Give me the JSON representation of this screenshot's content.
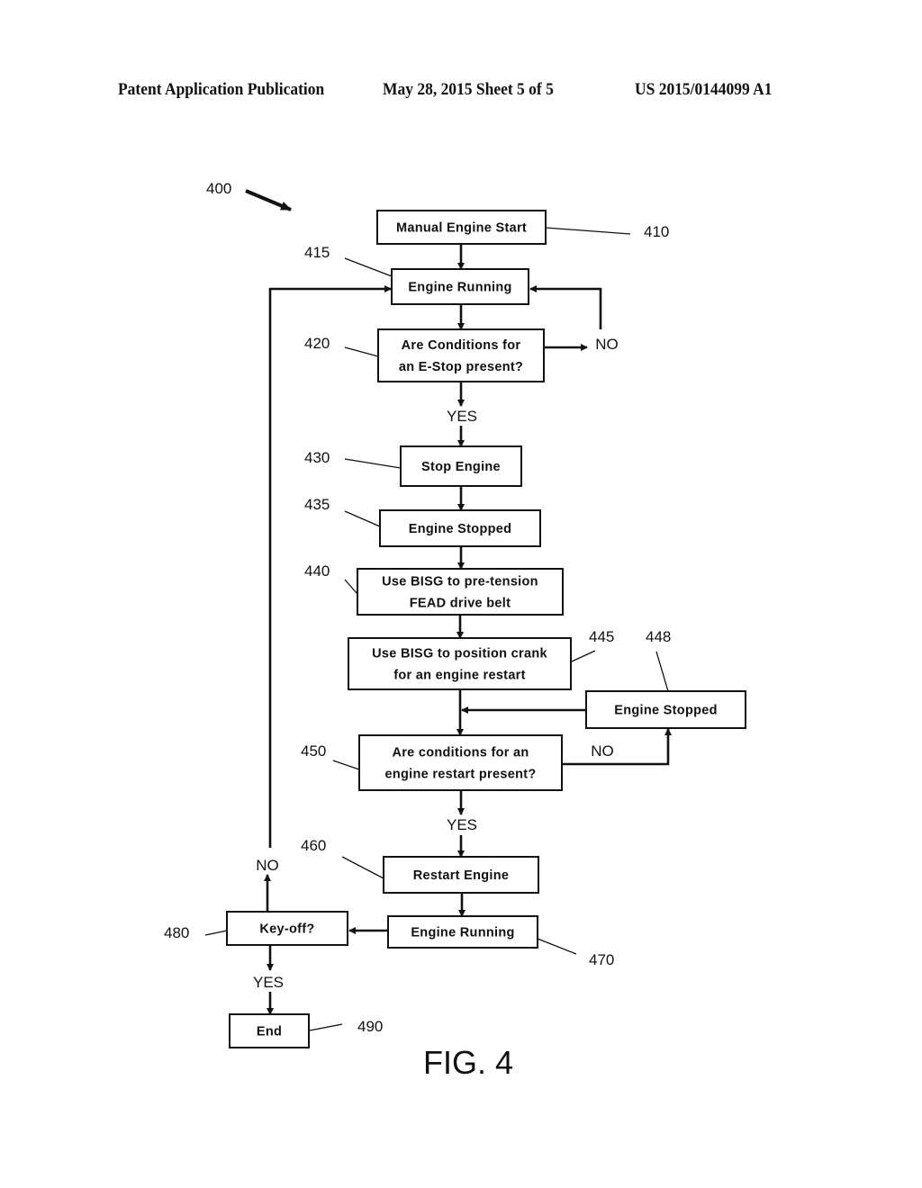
{
  "header": {
    "publication": "Patent Application Publication",
    "date_sheet": "May 28, 2015  Sheet 5 of 5",
    "number": "US 2015/0144099 A1"
  },
  "figure": {
    "ref": "400",
    "caption": "FIG. 4"
  },
  "nodes": [
    {
      "id": "410",
      "ref": "410",
      "lines": [
        "Manual Engine Start"
      ]
    },
    {
      "id": "415",
      "ref": "415",
      "lines": [
        "Engine Running"
      ]
    },
    {
      "id": "420",
      "ref": "420",
      "lines": [
        "Are Conditions for",
        "an E-Stop present?"
      ]
    },
    {
      "id": "430",
      "ref": "430",
      "lines": [
        "Stop Engine"
      ]
    },
    {
      "id": "435",
      "ref": "435",
      "lines": [
        "Engine Stopped"
      ]
    },
    {
      "id": "440",
      "ref": "440",
      "lines": [
        "Use BISG to pre-tension",
        "FEAD drive belt"
      ]
    },
    {
      "id": "445",
      "ref": "445",
      "lines": [
        "Use BISG to position crank",
        "for an engine restart"
      ]
    },
    {
      "id": "448",
      "ref": "448",
      "lines": [
        "Engine Stopped"
      ]
    },
    {
      "id": "450",
      "ref": "450",
      "lines": [
        "Are conditions for an",
        "engine restart present?"
      ]
    },
    {
      "id": "460",
      "ref": "460",
      "lines": [
        "Restart Engine"
      ]
    },
    {
      "id": "470",
      "ref": "470",
      "lines": [
        "Engine Running"
      ]
    },
    {
      "id": "480",
      "ref": "480",
      "lines": [
        "Key-off?"
      ]
    },
    {
      "id": "490",
      "ref": "490",
      "lines": [
        "End"
      ]
    }
  ],
  "edge_labels": {
    "e420_no": "NO",
    "e420_yes": "YES",
    "e450_no": "NO",
    "e450_yes": "YES",
    "e480_no": "NO",
    "e480_yes": "YES"
  }
}
